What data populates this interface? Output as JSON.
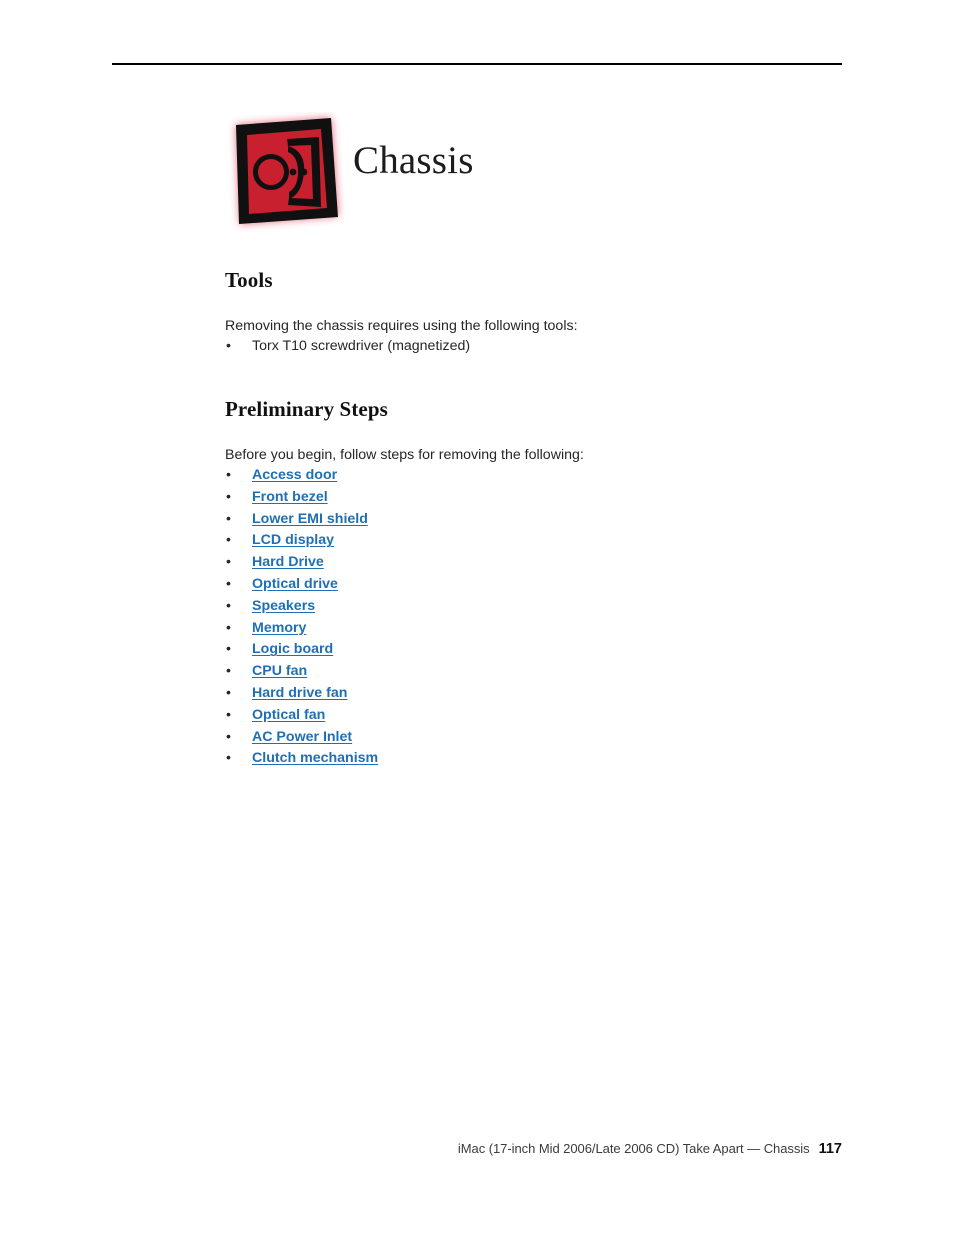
{
  "page": {
    "chapter_icon_name": "chassis-chapter-icon",
    "title": "Chassis",
    "icon_colors": {
      "red": "#C8202E",
      "ink": "#101010",
      "glow": "#E8657E"
    },
    "link_color": "#1F6FB5"
  },
  "sections": {
    "tools": {
      "heading": "Tools",
      "intro": "Removing the chassis requires using the following tools:",
      "items": [
        {
          "label": "Torx T10 screwdriver (magnetized)"
        }
      ]
    },
    "preliminary_steps": {
      "heading": "Preliminary Steps",
      "intro": "Before you begin, follow steps for removing the following:",
      "items": [
        {
          "label": "Access door"
        },
        {
          "label": "Front bezel"
        },
        {
          "label": "Lower EMI shield"
        },
        {
          "label": "LCD display"
        },
        {
          "label": "Hard Drive"
        },
        {
          "label": "Optical drive"
        },
        {
          "label": "Speakers"
        },
        {
          "label": "Memory"
        },
        {
          "label": "Logic board"
        },
        {
          "label": "CPU fan"
        },
        {
          "label": "Hard drive fan"
        },
        {
          "label": "Optical fan"
        },
        {
          "label": "AC Power Inlet"
        },
        {
          "label": "Clutch mechanism"
        }
      ]
    }
  },
  "bullet": {
    "glyph": "•"
  },
  "footer": {
    "text": "iMac (17-inch Mid 2006/Late 2006 CD) Take Apart — Chassis",
    "page_number": "117"
  }
}
